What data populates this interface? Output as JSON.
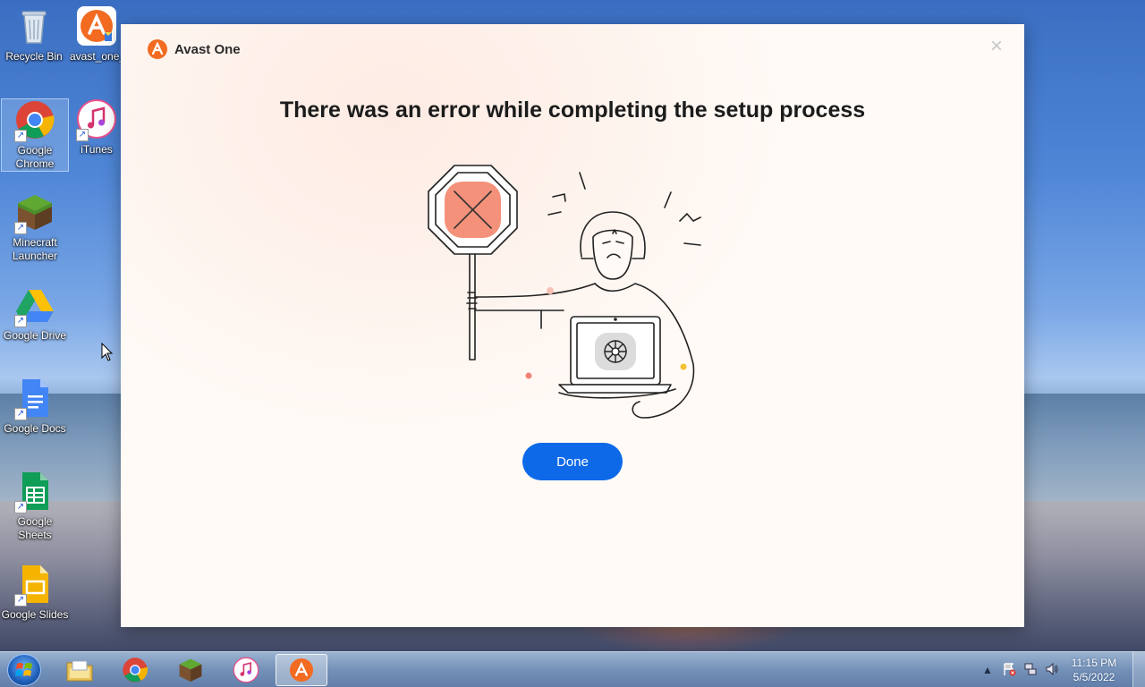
{
  "desktop": {
    "icons": [
      {
        "label": "Recycle Bin",
        "icon": "recycle-bin-icon"
      },
      {
        "label": "avast_one_",
        "icon": "avast-installer-icon"
      },
      {
        "label": "Google Chrome",
        "icon": "chrome-icon"
      },
      {
        "label": "iTunes",
        "icon": "itunes-icon"
      },
      {
        "label": "Minecraft Launcher",
        "icon": "minecraft-icon"
      },
      {
        "label": "Google Drive",
        "icon": "google-drive-icon"
      },
      {
        "label": "Google Docs",
        "icon": "google-docs-icon"
      },
      {
        "label": "Google Sheets",
        "icon": "google-sheets-icon"
      },
      {
        "label": "Google Slides",
        "icon": "google-slides-icon"
      }
    ]
  },
  "dialog": {
    "app_name": "Avast One",
    "close_glyph": "×",
    "title": "There was an error while completing the setup process",
    "done_label": "Done"
  },
  "taskbar": {
    "items": [
      "windows-explorer-icon",
      "chrome-icon",
      "minecraft-icon",
      "itunes-icon",
      "avast-icon"
    ],
    "clock": {
      "time": "11:15 PM",
      "date": "5/5/2022"
    }
  },
  "colors": {
    "accent": "#0d69e8",
    "brand": "#f26b21",
    "stop_sign": "#f4917a"
  }
}
